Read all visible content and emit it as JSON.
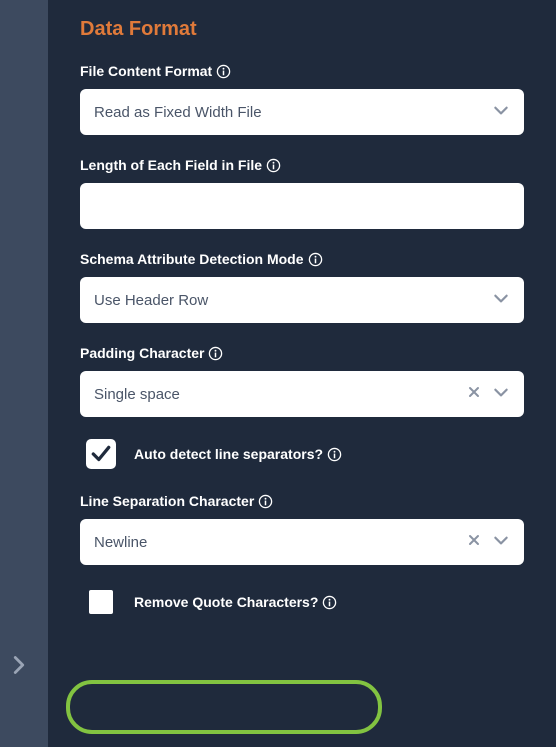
{
  "section": {
    "title": "Data Format"
  },
  "fields": {
    "fileContentFormat": {
      "label": "File Content Format",
      "value": "Read as Fixed Width File"
    },
    "lengthEachField": {
      "label": "Length of Each Field in File",
      "value": ""
    },
    "schemaAttrMode": {
      "label": "Schema Attribute Detection Mode",
      "value": "Use Header Row"
    },
    "paddingChar": {
      "label": "Padding Character",
      "value": "Single space"
    },
    "autoDetectLineSep": {
      "label": "Auto detect line separators?",
      "checked": true
    },
    "lineSepChar": {
      "label": "Line Separation Character",
      "value": "Newline"
    },
    "removeQuote": {
      "label": "Remove Quote Characters?",
      "checked": false
    }
  }
}
